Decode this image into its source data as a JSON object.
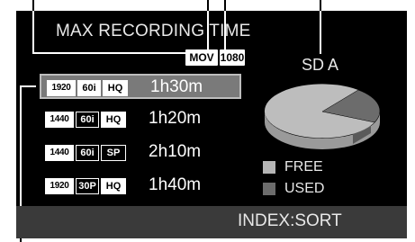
{
  "header": {
    "title": "MAX RECORDING TIME",
    "format_badge": "MOV",
    "resolution_badge": "1080",
    "card_label": "SD A"
  },
  "recording_modes": [
    {
      "resolution": "1920",
      "frame": "60i",
      "quality": "HQ",
      "duration": "1h30m",
      "selected": true
    },
    {
      "resolution": "1440",
      "frame": "60i",
      "quality": "HQ",
      "duration": "1h20m",
      "selected": false
    },
    {
      "resolution": "1440",
      "frame": "60i",
      "quality": "SP",
      "duration": "2h10m",
      "selected": false
    },
    {
      "resolution": "1920",
      "frame": "30P",
      "quality": "HQ",
      "duration": "1h40m",
      "selected": false
    }
  ],
  "legend": {
    "free_label": "FREE",
    "used_label": "USED",
    "free_color": "#b5b5b5",
    "used_color": "#6c6c6c"
  },
  "footer": {
    "hint": "INDEX:SORT"
  }
}
